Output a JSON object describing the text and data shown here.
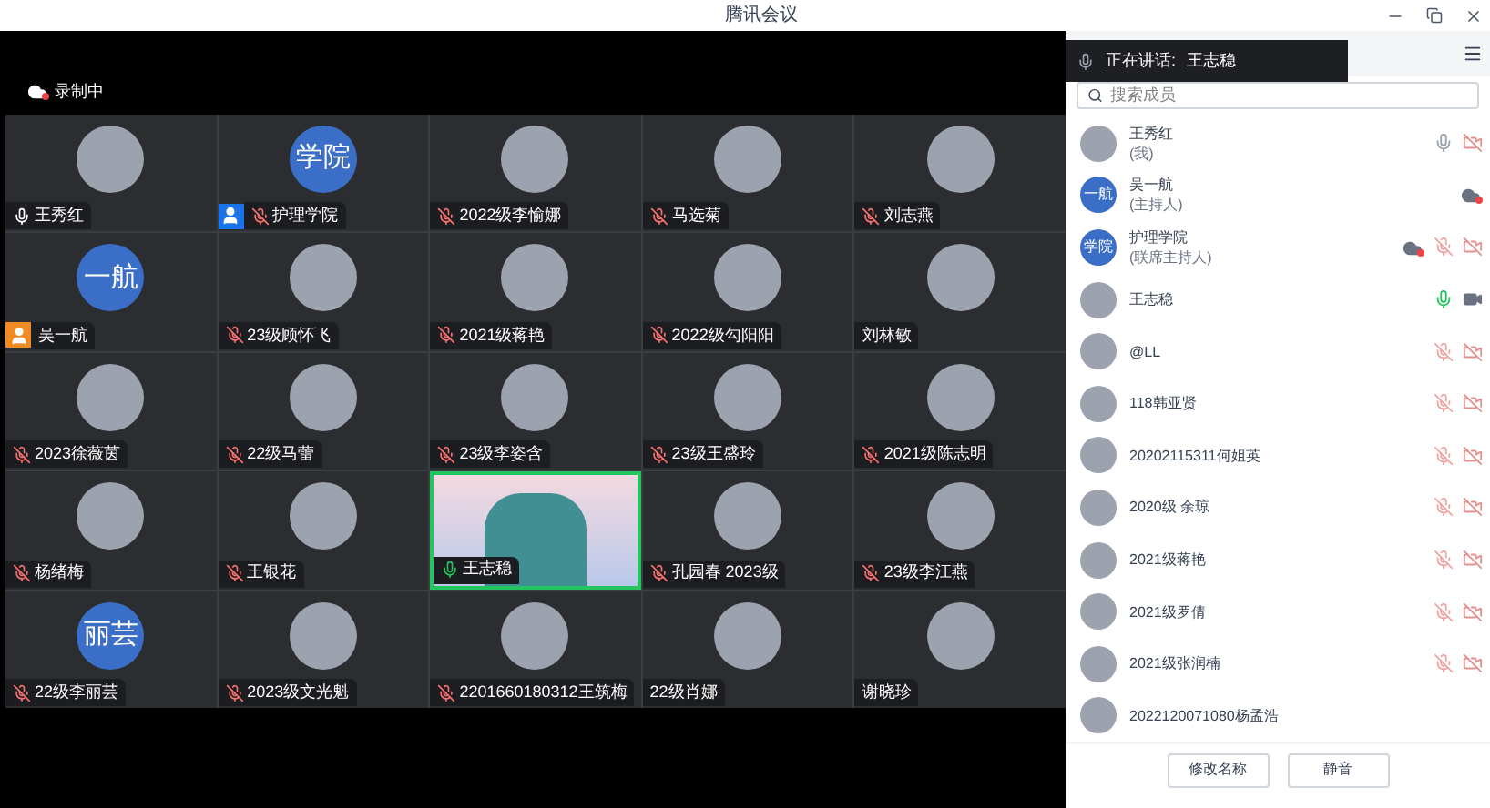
{
  "window": {
    "title": "腾讯会议"
  },
  "recording": {
    "label": "录制中"
  },
  "tiles": [
    {
      "name": "王秀红",
      "mic_shown": true,
      "muted": false,
      "speaking": false,
      "host": false,
      "cohost": false,
      "video": false
    },
    {
      "name": "护理学院",
      "avatar_text": "学院",
      "mic_shown": true,
      "muted": true,
      "speaking": false,
      "host": false,
      "cohost": true,
      "video": false
    },
    {
      "name": "2022级李愉娜",
      "mic_shown": true,
      "muted": true,
      "speaking": false,
      "host": false,
      "cohost": false,
      "video": false
    },
    {
      "name": "马选菊",
      "mic_shown": true,
      "muted": true,
      "speaking": false,
      "host": false,
      "cohost": false,
      "video": false
    },
    {
      "name": "刘志燕",
      "mic_shown": true,
      "muted": true,
      "speaking": false,
      "host": false,
      "cohost": false,
      "video": false
    },
    {
      "name": "吴一航",
      "avatar_text": "一航",
      "mic_shown": false,
      "host": true,
      "cohost": false,
      "video": false
    },
    {
      "name": "23级顾怀飞",
      "mic_shown": true,
      "muted": true,
      "speaking": false,
      "host": false,
      "cohost": false,
      "video": false
    },
    {
      "name": "2021级蒋艳",
      "mic_shown": true,
      "muted": true,
      "speaking": false,
      "host": false,
      "cohost": false,
      "video": false
    },
    {
      "name": "2022级勾阳阳",
      "mic_shown": true,
      "muted": true,
      "speaking": false,
      "host": false,
      "cohost": false,
      "video": false
    },
    {
      "name": "刘林敏",
      "mic_shown": false,
      "host": false,
      "cohost": false,
      "video": false
    },
    {
      "name": "2023徐薇茵",
      "mic_shown": true,
      "muted": true,
      "speaking": false,
      "host": false,
      "cohost": false,
      "video": false
    },
    {
      "name": "22级马蕾",
      "mic_shown": true,
      "muted": true,
      "speaking": false,
      "host": false,
      "cohost": false,
      "video": false
    },
    {
      "name": "23级李姿含",
      "mic_shown": true,
      "muted": true,
      "speaking": false,
      "host": false,
      "cohost": false,
      "video": false
    },
    {
      "name": "23级王盛玲",
      "mic_shown": true,
      "muted": true,
      "speaking": false,
      "host": false,
      "cohost": false,
      "video": false
    },
    {
      "name": "2021级陈志明",
      "mic_shown": true,
      "muted": true,
      "speaking": false,
      "host": false,
      "cohost": false,
      "video": false
    },
    {
      "name": "杨绪梅",
      "mic_shown": true,
      "muted": true,
      "speaking": false,
      "host": false,
      "cohost": false,
      "video": false
    },
    {
      "name": "王银花",
      "mic_shown": true,
      "muted": true,
      "speaking": false,
      "host": false,
      "cohost": false,
      "video": false
    },
    {
      "name": "王志稳",
      "mic_shown": true,
      "muted": false,
      "speaking": true,
      "host": false,
      "cohost": false,
      "video": true
    },
    {
      "name": "孔园春 2023级",
      "mic_shown": true,
      "muted": true,
      "speaking": false,
      "host": false,
      "cohost": false,
      "video": false
    },
    {
      "name": "23级李江燕",
      "mic_shown": true,
      "muted": true,
      "speaking": false,
      "host": false,
      "cohost": false,
      "video": false
    },
    {
      "name": "22级李丽芸",
      "avatar_text": "丽芸",
      "mic_shown": true,
      "muted": true,
      "speaking": false,
      "host": false,
      "cohost": false,
      "video": false
    },
    {
      "name": "2023级文光魁",
      "mic_shown": true,
      "muted": true,
      "speaking": false,
      "host": false,
      "cohost": false,
      "video": false
    },
    {
      "name": "2201660180312王筑梅",
      "mic_shown": true,
      "muted": true,
      "speaking": false,
      "host": false,
      "cohost": false,
      "video": false
    },
    {
      "name": "22级肖娜",
      "mic_shown": false,
      "host": false,
      "cohost": false,
      "video": false
    },
    {
      "name": "谢晓珍",
      "mic_shown": false,
      "host": false,
      "cohost": false,
      "video": false
    }
  ],
  "speaking_banner": {
    "label": "正在讲话:",
    "name": "王志稳"
  },
  "search": {
    "placeholder": "搜索成员"
  },
  "members": [
    {
      "name": "王秀红",
      "note": "(我)",
      "recording": false,
      "mic_shown": true,
      "muted": false,
      "speaking": false,
      "camera_shown": true,
      "camera_on": false
    },
    {
      "name": "吴一航",
      "note": "(主持人)",
      "avatar_text": "一航",
      "recording": true,
      "mic_shown": false,
      "camera_shown": false
    },
    {
      "name": "护理学院",
      "note": "(联席主持人)",
      "avatar_text": "学院",
      "recording": true,
      "mic_shown": true,
      "muted": true,
      "speaking": false,
      "camera_shown": true,
      "camera_on": false
    },
    {
      "name": "王志稳",
      "recording": false,
      "mic_shown": true,
      "muted": false,
      "speaking": true,
      "camera_shown": true,
      "camera_on": true
    },
    {
      "name": "@LL",
      "recording": false,
      "mic_shown": true,
      "muted": true,
      "speaking": false,
      "camera_shown": true,
      "camera_on": false
    },
    {
      "name": "118韩亚贤",
      "recording": false,
      "mic_shown": true,
      "muted": true,
      "speaking": false,
      "camera_shown": true,
      "camera_on": false
    },
    {
      "name": "20202115311何姐英",
      "recording": false,
      "mic_shown": true,
      "muted": true,
      "speaking": false,
      "camera_shown": true,
      "camera_on": false
    },
    {
      "name": "2020级 余琼",
      "recording": false,
      "mic_shown": true,
      "muted": true,
      "speaking": false,
      "camera_shown": true,
      "camera_on": false
    },
    {
      "name": "2021级蒋艳",
      "recording": false,
      "mic_shown": true,
      "muted": true,
      "speaking": false,
      "camera_shown": true,
      "camera_on": false
    },
    {
      "name": "2021级罗倩",
      "recording": false,
      "mic_shown": true,
      "muted": true,
      "speaking": false,
      "camera_shown": true,
      "camera_on": false
    },
    {
      "name": "2021级张润楠",
      "recording": false,
      "mic_shown": true,
      "muted": true,
      "speaking": false,
      "camera_shown": true,
      "camera_on": false
    },
    {
      "name": "2022120071080杨孟浩",
      "recording": false,
      "mic_shown": false,
      "camera_shown": false
    }
  ],
  "buttons": [
    "修改名称",
    "静音"
  ]
}
